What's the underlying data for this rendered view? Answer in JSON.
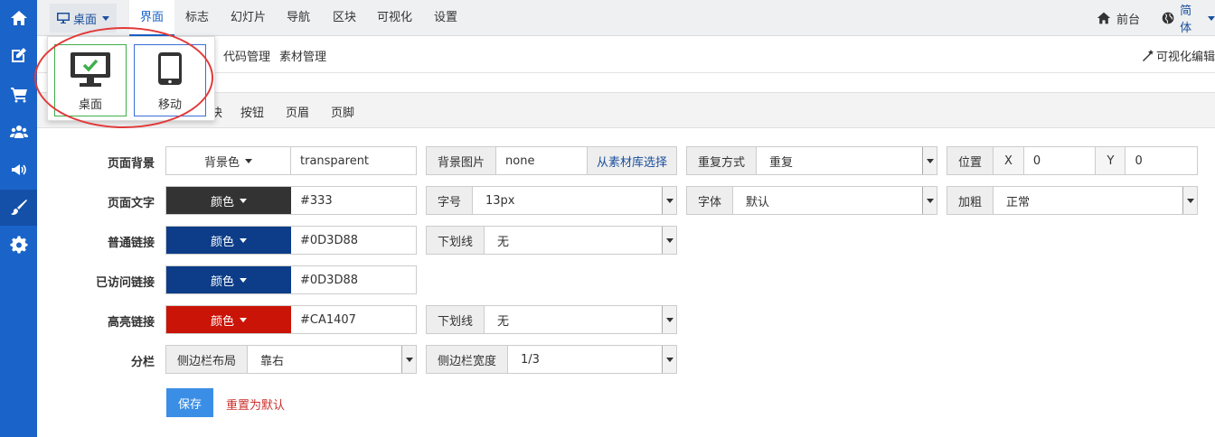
{
  "sidebar": {
    "items": [
      {
        "icon": "home-icon"
      },
      {
        "icon": "edit-icon"
      },
      {
        "icon": "cart-icon"
      },
      {
        "icon": "users-icon"
      },
      {
        "icon": "megaphone-icon"
      },
      {
        "icon": "brush-icon",
        "active": true
      },
      {
        "icon": "gear-icon"
      }
    ]
  },
  "topnav": {
    "device_label": "桌面",
    "tabs": [
      "界面",
      "标志",
      "幻灯片",
      "导航",
      "区块",
      "可视化",
      "设置"
    ],
    "home_label": "前台",
    "lang_label": "简体"
  },
  "subnav": {
    "items": [
      "代码管理",
      "素材管理"
    ],
    "vis_edit": "可视化编辑"
  },
  "tabs": {
    "items": [
      "块",
      "按钮",
      "页眉",
      "页脚"
    ]
  },
  "device_popup": {
    "desktop_label": "桌面",
    "mobile_label": "移动"
  },
  "form": {
    "page_bg": {
      "label": "页面背景",
      "bg_color_btn": "背景色",
      "bg_color_value": "transparent",
      "bg_image_label": "背景图片",
      "bg_image_value": "none",
      "bg_image_pick": "从素材库选择",
      "repeat_label": "重复方式",
      "repeat_value": "重复",
      "position_label": "位置",
      "x_label": "X",
      "x_value": "0",
      "y_label": "Y",
      "y_value": "0"
    },
    "page_text": {
      "label": "页面文字",
      "color_btn": "颜色",
      "color_value": "#333",
      "swatch": "#333333",
      "size_label": "字号",
      "size_value": "13px",
      "font_label": "字体",
      "font_value": "默认",
      "bold_label": "加粗",
      "bold_value": "正常"
    },
    "normal_link": {
      "label": "普通链接",
      "color_btn": "颜色",
      "color_value": "#0D3D88",
      "swatch": "#0D3D88",
      "underline_label": "下划线",
      "underline_value": "无"
    },
    "visited_link": {
      "label": "已访问链接",
      "color_btn": "颜色",
      "color_value": "#0D3D88",
      "swatch": "#0D3D88"
    },
    "highlight_link": {
      "label": "高亮链接",
      "color_btn": "颜色",
      "color_value": "#CA1407",
      "swatch": "#CA1407",
      "underline_label": "下划线",
      "underline_value": "无"
    },
    "columns": {
      "label": "分栏",
      "layout_label": "侧边栏布局",
      "layout_value": "靠右",
      "width_label": "侧边栏宽度",
      "width_value": "1/3"
    },
    "save_label": "保存",
    "reset_label": "重置为默认"
  }
}
